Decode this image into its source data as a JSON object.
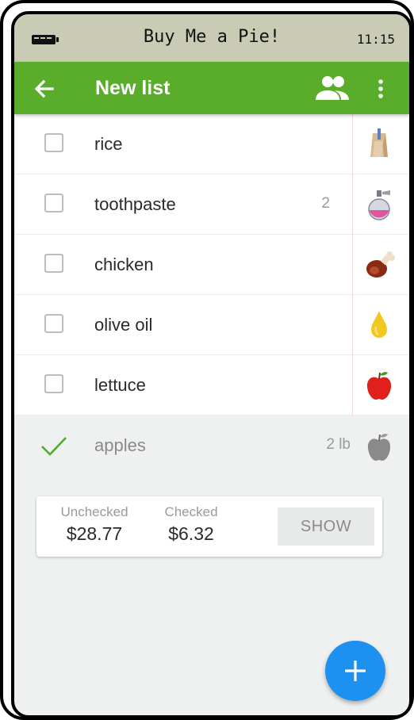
{
  "status_bar": {
    "app_name": "Buy Me a Pie!",
    "time": "11:15",
    "battery_icon": "battery-icon"
  },
  "app_bar": {
    "title": "New list",
    "back_icon": "arrow-back-icon",
    "share_icon": "people-icon",
    "menu_icon": "more-vert-icon",
    "color": "#5aac2b"
  },
  "items": [
    {
      "name": "rice",
      "qty": "",
      "icon": "paper-bag-icon",
      "checked": false
    },
    {
      "name": "toothpaste",
      "qty": "2",
      "icon": "cosmetics-bottle-icon",
      "checked": false
    },
    {
      "name": "chicken",
      "qty": "",
      "icon": "ham-leg-icon",
      "checked": false
    },
    {
      "name": "olive oil",
      "qty": "",
      "icon": "oil-drop-icon",
      "checked": false
    },
    {
      "name": "lettuce",
      "qty": "",
      "icon": "red-apple-icon",
      "checked": false
    }
  ],
  "checked_items": [
    {
      "name": "apples",
      "qty": "2 lb",
      "icon": "grey-apple-icon",
      "checked": true
    }
  ],
  "summary": {
    "unchecked_label": "Unchecked",
    "unchecked_value": "$28.77",
    "checked_label": "Checked",
    "checked_value": "$6.32",
    "show_label": "SHOW"
  },
  "fab": {
    "icon": "plus-icon",
    "color": "#1e90f0"
  }
}
